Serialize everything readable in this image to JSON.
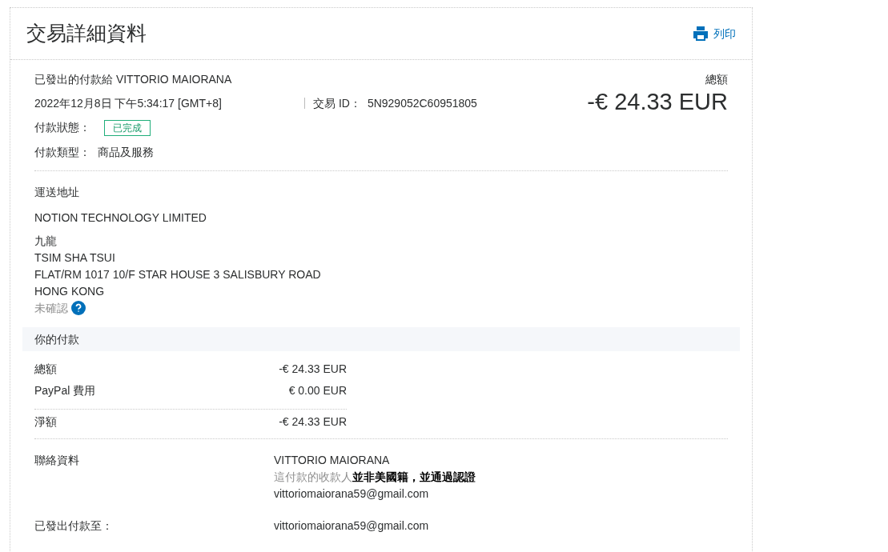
{
  "header": {
    "title": "交易詳細資料",
    "print_label": "列印"
  },
  "summary": {
    "payee_line": "已發出的付款給 VITTORIO MAIORANA",
    "datetime": "2022年12月8日 下午5:34:17 [GMT+8]",
    "transaction_id_label": "交易 ID：",
    "transaction_id": "5N929052C60951805",
    "total_label": "總額",
    "total": "-€ 24.33 EUR",
    "status_label": "付款狀態：",
    "status": "已完成",
    "type_label": "付款類型：",
    "type": "商品及服務"
  },
  "shipping": {
    "heading": "運送地址",
    "name": "NOTION TECHNOLOGY LIMITED",
    "lines": [
      "九龍",
      "TSIM SHA TSUI",
      "FLAT/RM 1017 10/F STAR HOUSE 3 SALISBURY ROAD",
      "HONG KONG"
    ],
    "verification": "未確認"
  },
  "payment": {
    "heading": "你的付款",
    "rows": [
      {
        "label": "總額",
        "value": "-€ 24.33 EUR"
      },
      {
        "label": "PayPal 費用",
        "value": "€ 0.00 EUR"
      }
    ],
    "net": {
      "label": "淨額",
      "value": "-€ 24.33 EUR"
    }
  },
  "contact": {
    "label": "聯絡資料",
    "name": "VITTORIO MAIORANA",
    "note": "這付款的收款人**並非美國籍，並通過認證**",
    "email": "vittoriomaiorana59@gmail.com"
  },
  "sent_to": {
    "label": "已發出付款至：",
    "email": "vittoriomaiorana59@gmail.com"
  }
}
